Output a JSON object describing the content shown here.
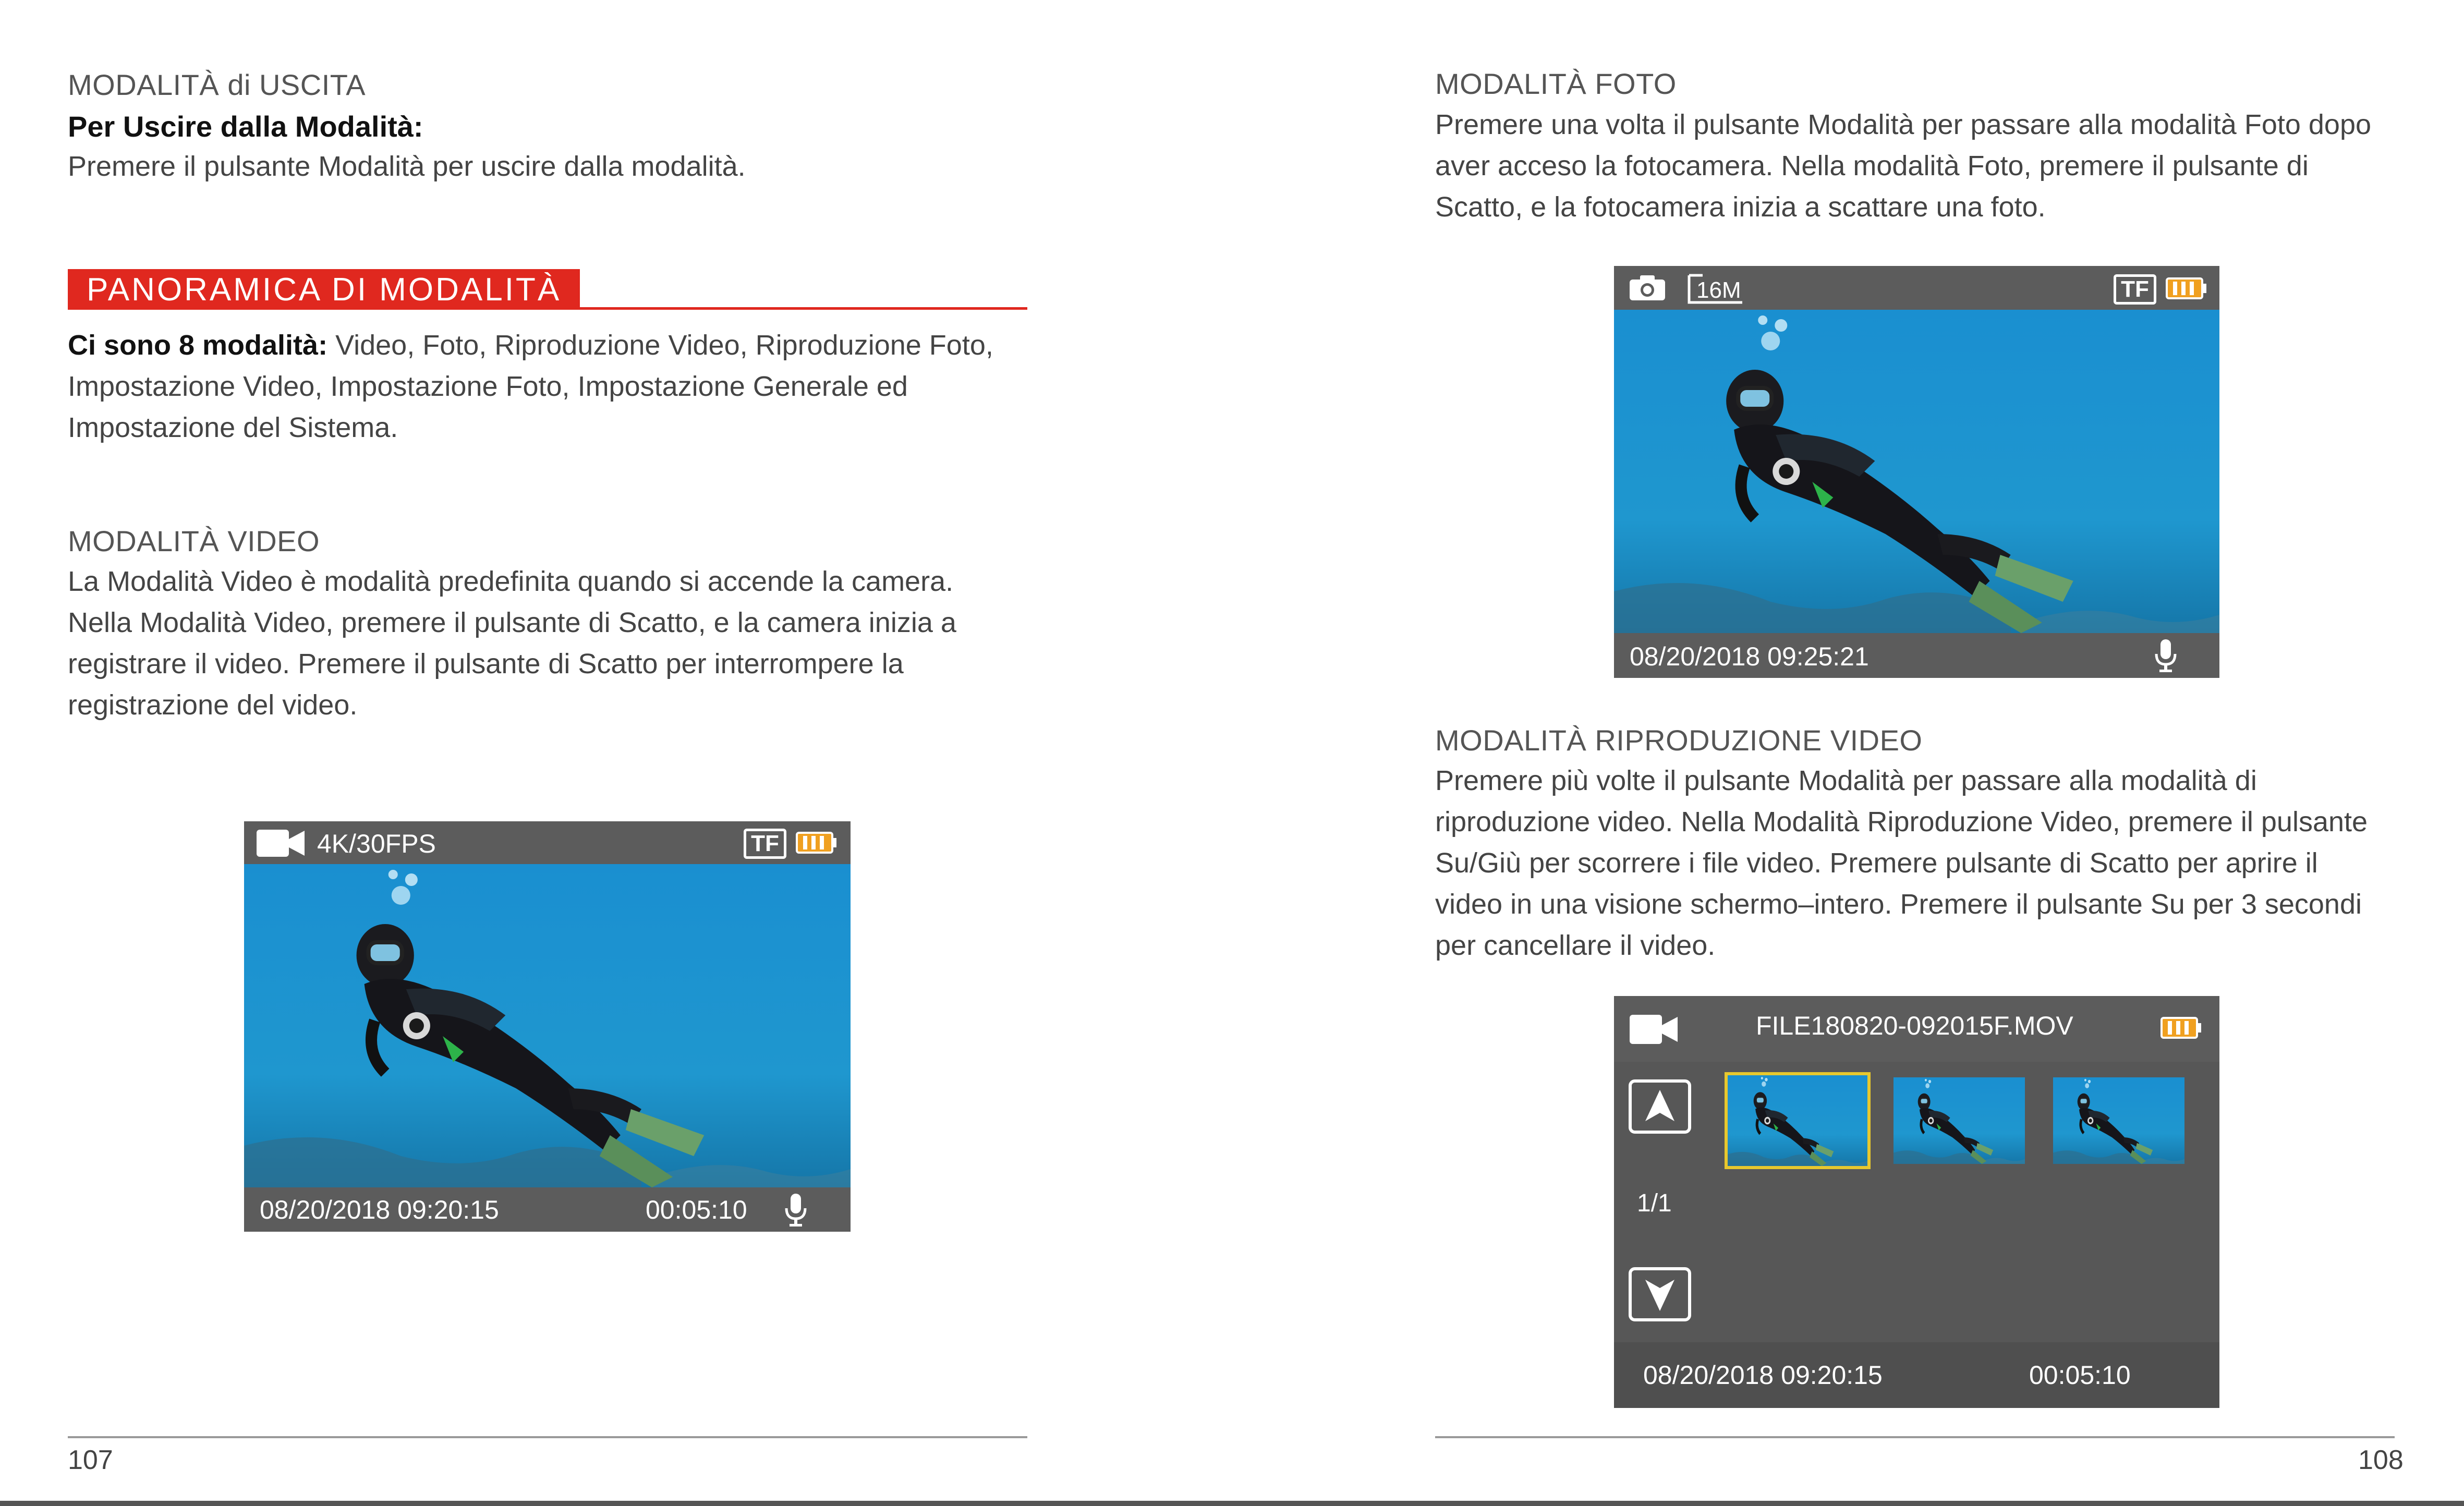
{
  "left_page": {
    "exit_section": {
      "heading": "MODALITÀ di USCITA",
      "subheading": "Per Uscire dalla Modalità:",
      "text": "Premere il pulsante Modalità per uscire dalla modalità."
    },
    "overview_banner": "PANORAMICA DI MODALITÀ",
    "overview_text_bold": "Ci sono 8 modalità:",
    "overview_text": " Video, Foto, Riproduzione Video, Riproduzione Foto, Impostazione Video, Impostazione Foto, Impostazione Generale ed Impostazione del Sistema.",
    "video_section": {
      "heading": "MODALITÀ VIDEO",
      "text": "La  Modalità Video è modalità predefinita quando si accende la camera. Nella Modalità Video, premere il pulsante di Scatto, e la camera inizia a registrare il video. Premere il pulsante di Scatto per interrompere la registrazione del video."
    },
    "video_screen": {
      "mode_icon": "video-camera-icon",
      "resolution": "4K/30FPS",
      "tf_label": "TF",
      "datetime": "08/20/2018 09:20:15",
      "duration": "00:05:10",
      "mic_icon": "microphone-icon",
      "battery_icon": "battery-icon"
    },
    "page_number": "107"
  },
  "right_page": {
    "photo_section": {
      "heading": "MODALITÀ FOTO",
      "text": "Premere una volta il pulsante Modalità per passare alla modalità Foto dopo aver acceso la fotocamera. Nella modalità Foto, premere il pulsante di Scatto, e la fotocamera inizia a  scattare una foto."
    },
    "photo_screen": {
      "mode_icon": "photo-camera-icon",
      "resolution": "16M",
      "tf_label": "TF",
      "datetime": "08/20/2018 09:25:21",
      "mic_icon": "microphone-icon",
      "battery_icon": "battery-icon"
    },
    "playback_section": {
      "heading": "MODALITÀ RIPRODUZIONE VIDEO",
      "text": "Premere più volte il pulsante Modalità per passare alla modalità di riproduzione video. Nella Modalità Riproduzione Video, premere il pulsante Su/Giù per scorrere i file video. Premere pulsante di Scatto per aprire il video in una visione schermo–intero. Premere il pulsante Su per 3 secondi per cancellare il video."
    },
    "playback_screen": {
      "mode_icon": "video-camera-icon",
      "filename": "FILE180820-092015F.MOV",
      "page_indicator": "1/1",
      "datetime": "08/20/2018 09:20:15",
      "duration": "00:05:10",
      "up_icon": "arrow-up-icon",
      "down_icon": "arrow-down-icon",
      "battery_icon": "battery-icon"
    },
    "page_number": "108"
  },
  "colors": {
    "accent_red": "#e0281f",
    "screen_gray": "#575757",
    "battery_orange": "#f0a020",
    "selection_yellow": "#e8c82e",
    "water_blue": "#1f8fc4"
  }
}
